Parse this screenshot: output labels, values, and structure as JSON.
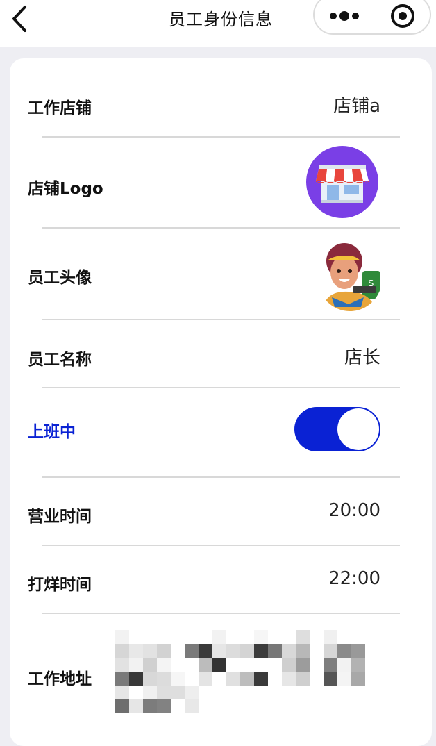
{
  "navbar": {
    "title": "员工身份信息",
    "back_icon": "chevron-left-icon",
    "more_icon": "more-dots-icon",
    "target_icon": "target-icon"
  },
  "fields": {
    "store": {
      "label": "工作店铺",
      "value": "店铺a"
    },
    "store_logo": {
      "label": "店铺Logo",
      "icon": "storefront-icon"
    },
    "avatar": {
      "label": "员工头像",
      "icon": "avatar-image"
    },
    "name": {
      "label": "员工名称",
      "value": "店长"
    },
    "on_duty": {
      "label": "上班中",
      "checked": true
    },
    "business_hours": {
      "label": "营业时间",
      "value": "20:00"
    },
    "closing_time": {
      "label": "打烊时间",
      "value": "22:00"
    },
    "address": {
      "label": "工作地址",
      "value_obscured": true
    }
  },
  "colors": {
    "accent": "#0a22d4",
    "logo_bg": "#7a3fe6",
    "page_bg": "#eeeef3"
  }
}
